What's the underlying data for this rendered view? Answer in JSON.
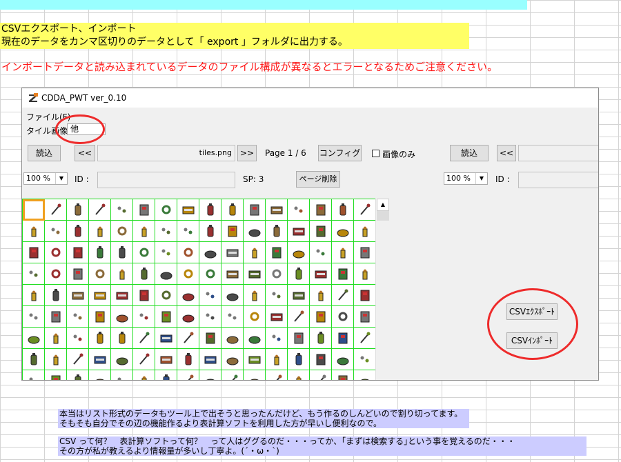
{
  "sheet": {
    "line1": "CSVエクスポート、インポート",
    "line2": "現在のデータをカンマ区切りのデータとして「 export 」フォルダに出力する。",
    "warning": "インポートデータと読み込まれているデータのファイル構成が異なるとエラーとなるためご注意ください。",
    "note1": "本当はリスト形式のデータもツール上で出そうと思ったんだけど、もう作るのしんどいので割り切ってます。",
    "note2": "そもそも自分でその辺の機能作るより表計算ソフトを利用した方が早いし便利なので。",
    "note3": "CSV って何？　表計算ソフトって何？　って人はググるのだ・・・ってか、｢まずは検索する｣という事を覚えるのだ・・・",
    "note4": "その方が私が教えるより情報量が多いし丁寧よ。(´・ω・`)"
  },
  "window": {
    "title": "CDDA_PWT  ver_0.10",
    "menu_file": "ファイル(F)",
    "tile_label": "タイル画像",
    "tile_value": "他",
    "left": {
      "load": "読込",
      "prev": "<<",
      "file": "tiles.png",
      "next": ">>",
      "page": "Page 1 / 6",
      "config": "コンフィグ",
      "image_only": "画像のみ",
      "zoom": "100 %",
      "id_label": "ID :",
      "sp": "SP: 3",
      "delete_page": "ページ削除"
    },
    "right": {
      "load": "読込",
      "prev": "<<",
      "zoom": "100 %",
      "id_label": "ID :"
    },
    "csv_export": "CSVｴｸｽﾎﾟｰﾄ",
    "csv_import": "CSVｲﾝﾎﾟｰﾄ"
  },
  "colors": {
    "highlight_yellow": "#ffff66",
    "highlight_cyan": "#99ffff",
    "highlight_purple": "#ccccff",
    "warning_red": "#ff1a1a",
    "annotation_red": "#ee2b2b",
    "grid_green": "#22dd22"
  }
}
